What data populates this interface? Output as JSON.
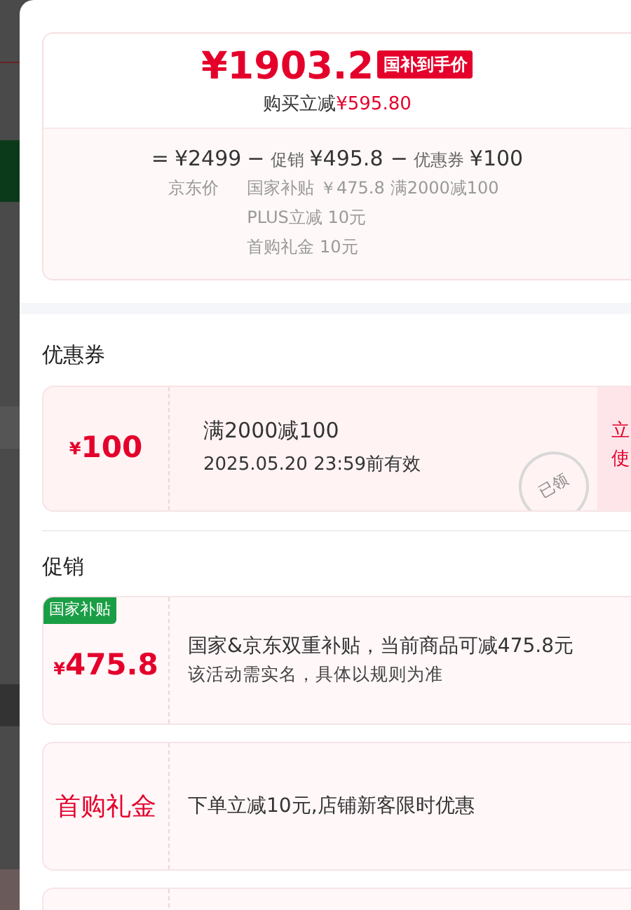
{
  "price": {
    "final": "¥1903.2",
    "badge": "国补到手价",
    "saving_label": "购买立减",
    "saving": "¥595.80"
  },
  "breakdown": [
    {
      "operator": "=",
      "amount": "¥2499",
      "notes": [
        "京东价"
      ]
    },
    {
      "operator": "−",
      "label": "促销",
      "amount": "¥495.8",
      "notes": [
        "国家补贴 ￥475.8",
        "PLUS立减 10元",
        "首购礼金 10元"
      ]
    },
    {
      "operator": "−",
      "label": "优惠券",
      "amount": "¥100",
      "notes": [
        "满2000减100"
      ]
    }
  ],
  "coupons": {
    "title": "优惠券",
    "items": [
      {
        "symbol": "¥",
        "amount": "100",
        "condition": "满2000减100",
        "validity": "2025.05.20 23:59前有效",
        "stamp": "已领",
        "action_lines": [
          "立",
          "使"
        ]
      }
    ]
  },
  "promotions": {
    "title": "促销",
    "items": [
      {
        "kind": "amount",
        "tag": "国家补贴",
        "symbol": "¥",
        "amount": "475.8",
        "text": "国家&京东双重补贴，当前商品可减475.8元",
        "note": "该活动需实名，具体以规则为准"
      },
      {
        "kind": "label",
        "label": "首购礼金",
        "text": "下单立减10元,店铺新客限时优惠"
      },
      {
        "kind": "empty"
      }
    ]
  }
}
